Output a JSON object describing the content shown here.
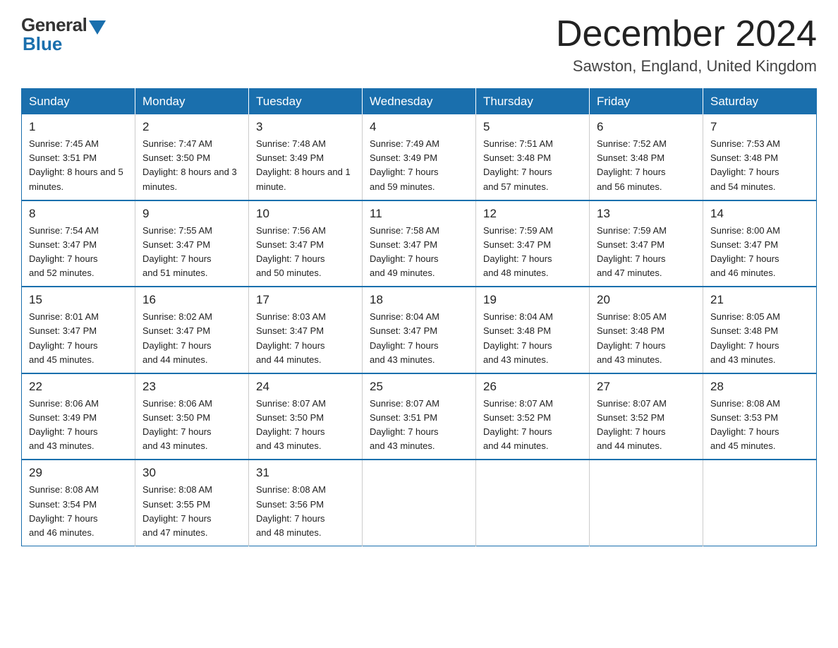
{
  "header": {
    "logo_general": "General",
    "logo_blue": "Blue",
    "month_title": "December 2024",
    "location": "Sawston, England, United Kingdom"
  },
  "days_of_week": [
    "Sunday",
    "Monday",
    "Tuesday",
    "Wednesday",
    "Thursday",
    "Friday",
    "Saturday"
  ],
  "weeks": [
    [
      {
        "day": "1",
        "sunrise": "7:45 AM",
        "sunset": "3:51 PM",
        "daylight": "8 hours and 5 minutes."
      },
      {
        "day": "2",
        "sunrise": "7:47 AM",
        "sunset": "3:50 PM",
        "daylight": "8 hours and 3 minutes."
      },
      {
        "day": "3",
        "sunrise": "7:48 AM",
        "sunset": "3:49 PM",
        "daylight": "8 hours and 1 minute."
      },
      {
        "day": "4",
        "sunrise": "7:49 AM",
        "sunset": "3:49 PM",
        "daylight": "7 hours and 59 minutes."
      },
      {
        "day": "5",
        "sunrise": "7:51 AM",
        "sunset": "3:48 PM",
        "daylight": "7 hours and 57 minutes."
      },
      {
        "day": "6",
        "sunrise": "7:52 AM",
        "sunset": "3:48 PM",
        "daylight": "7 hours and 56 minutes."
      },
      {
        "day": "7",
        "sunrise": "7:53 AM",
        "sunset": "3:48 PM",
        "daylight": "7 hours and 54 minutes."
      }
    ],
    [
      {
        "day": "8",
        "sunrise": "7:54 AM",
        "sunset": "3:47 PM",
        "daylight": "7 hours and 52 minutes."
      },
      {
        "day": "9",
        "sunrise": "7:55 AM",
        "sunset": "3:47 PM",
        "daylight": "7 hours and 51 minutes."
      },
      {
        "day": "10",
        "sunrise": "7:56 AM",
        "sunset": "3:47 PM",
        "daylight": "7 hours and 50 minutes."
      },
      {
        "day": "11",
        "sunrise": "7:58 AM",
        "sunset": "3:47 PM",
        "daylight": "7 hours and 49 minutes."
      },
      {
        "day": "12",
        "sunrise": "7:59 AM",
        "sunset": "3:47 PM",
        "daylight": "7 hours and 48 minutes."
      },
      {
        "day": "13",
        "sunrise": "7:59 AM",
        "sunset": "3:47 PM",
        "daylight": "7 hours and 47 minutes."
      },
      {
        "day": "14",
        "sunrise": "8:00 AM",
        "sunset": "3:47 PM",
        "daylight": "7 hours and 46 minutes."
      }
    ],
    [
      {
        "day": "15",
        "sunrise": "8:01 AM",
        "sunset": "3:47 PM",
        "daylight": "7 hours and 45 minutes."
      },
      {
        "day": "16",
        "sunrise": "8:02 AM",
        "sunset": "3:47 PM",
        "daylight": "7 hours and 44 minutes."
      },
      {
        "day": "17",
        "sunrise": "8:03 AM",
        "sunset": "3:47 PM",
        "daylight": "7 hours and 44 minutes."
      },
      {
        "day": "18",
        "sunrise": "8:04 AM",
        "sunset": "3:47 PM",
        "daylight": "7 hours and 43 minutes."
      },
      {
        "day": "19",
        "sunrise": "8:04 AM",
        "sunset": "3:48 PM",
        "daylight": "7 hours and 43 minutes."
      },
      {
        "day": "20",
        "sunrise": "8:05 AM",
        "sunset": "3:48 PM",
        "daylight": "7 hours and 43 minutes."
      },
      {
        "day": "21",
        "sunrise": "8:05 AM",
        "sunset": "3:48 PM",
        "daylight": "7 hours and 43 minutes."
      }
    ],
    [
      {
        "day": "22",
        "sunrise": "8:06 AM",
        "sunset": "3:49 PM",
        "daylight": "7 hours and 43 minutes."
      },
      {
        "day": "23",
        "sunrise": "8:06 AM",
        "sunset": "3:50 PM",
        "daylight": "7 hours and 43 minutes."
      },
      {
        "day": "24",
        "sunrise": "8:07 AM",
        "sunset": "3:50 PM",
        "daylight": "7 hours and 43 minutes."
      },
      {
        "day": "25",
        "sunrise": "8:07 AM",
        "sunset": "3:51 PM",
        "daylight": "7 hours and 43 minutes."
      },
      {
        "day": "26",
        "sunrise": "8:07 AM",
        "sunset": "3:52 PM",
        "daylight": "7 hours and 44 minutes."
      },
      {
        "day": "27",
        "sunrise": "8:07 AM",
        "sunset": "3:52 PM",
        "daylight": "7 hours and 44 minutes."
      },
      {
        "day": "28",
        "sunrise": "8:08 AM",
        "sunset": "3:53 PM",
        "daylight": "7 hours and 45 minutes."
      }
    ],
    [
      {
        "day": "29",
        "sunrise": "8:08 AM",
        "sunset": "3:54 PM",
        "daylight": "7 hours and 46 minutes."
      },
      {
        "day": "30",
        "sunrise": "8:08 AM",
        "sunset": "3:55 PM",
        "daylight": "7 hours and 47 minutes."
      },
      {
        "day": "31",
        "sunrise": "8:08 AM",
        "sunset": "3:56 PM",
        "daylight": "7 hours and 48 minutes."
      },
      null,
      null,
      null,
      null
    ]
  ]
}
